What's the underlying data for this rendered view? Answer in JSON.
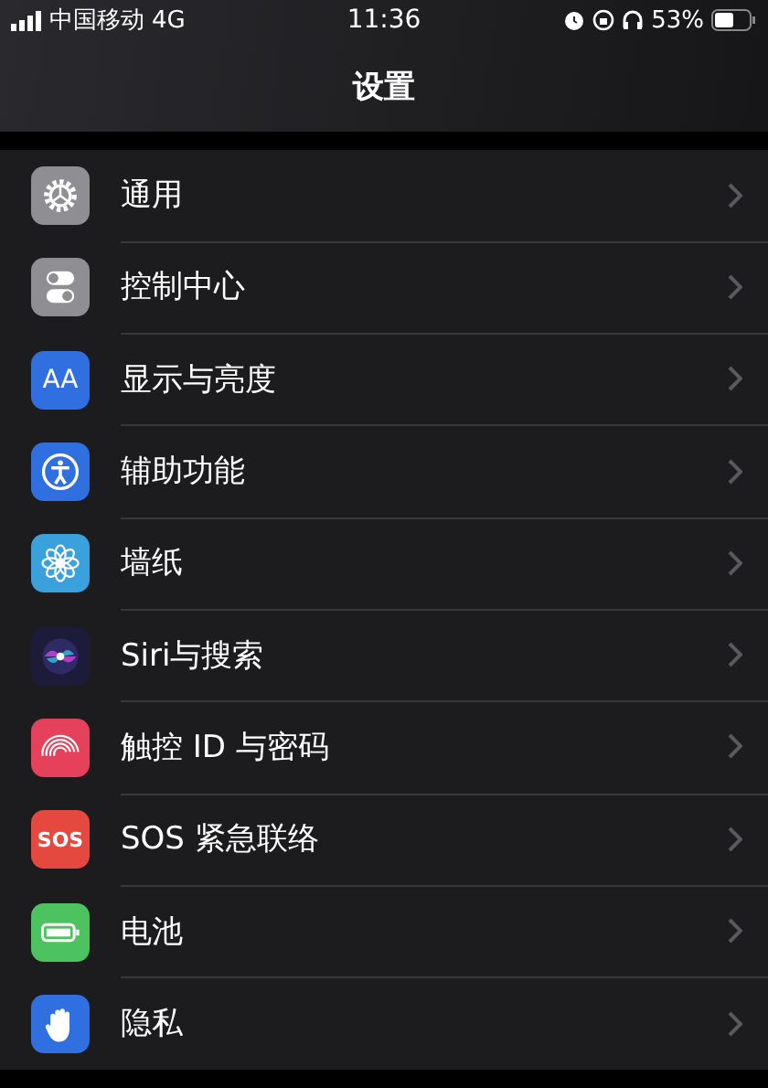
{
  "status_bar": {
    "carrier": "中国移动",
    "network": "4G",
    "time": "11:36",
    "battery_percent": "53%"
  },
  "title": "设置",
  "items": [
    {
      "label": "通用",
      "kind": "gear",
      "color": "#8e8e93"
    },
    {
      "label": "控制中心",
      "kind": "toggles",
      "color": "#8e8e93"
    },
    {
      "label": "显示与亮度",
      "kind": "text",
      "icon_text": "AA",
      "color": "#2f6fe0"
    },
    {
      "label": "辅助功能",
      "kind": "person",
      "color": "#2f6fe0"
    },
    {
      "label": "墙纸",
      "kind": "flower",
      "color": "#3aa1dc"
    },
    {
      "label": "Siri与搜索",
      "kind": "orb",
      "color": "#1c1c3a"
    },
    {
      "label": "触控 ID 与密码",
      "kind": "fingerprint",
      "color": "#e5415a"
    },
    {
      "label": "SOS 紧急联络",
      "kind": "text",
      "icon_text": "SOS",
      "color": "#e5483f"
    },
    {
      "label": "电池",
      "kind": "battery",
      "color": "#4cc35e"
    },
    {
      "label": "隐私",
      "kind": "hand",
      "color": "#2f6fe0"
    }
  ]
}
